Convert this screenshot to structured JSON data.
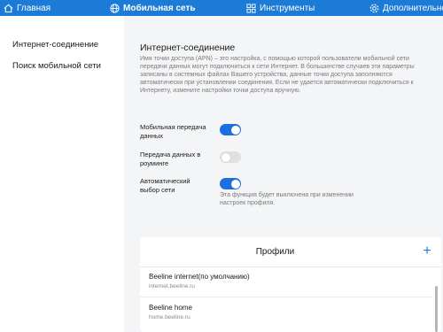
{
  "nav": {
    "home": "Главная",
    "mobile_network": "Мобильная сеть",
    "tools": "Инструменты",
    "advanced": "Дополнительно"
  },
  "sidebar": {
    "items": [
      {
        "label": "Интернет-соединение",
        "active": true
      },
      {
        "label": "Поиск мобильной сети",
        "active": false
      }
    ]
  },
  "section": {
    "title": "Интернет-соединение",
    "description": "Имя точки доступа (APN) – это настройка, с помощью которой пользователи мобильной сети передачи данных могут подключиться к сети Интернет. В большинстве случаев эти параметры записаны в системных файлах Вашего устройства, данные точки доступа заполняются автоматически при установлении соединения. Если не удается автоматически подключиться к Интернету, измените настройки точки доступа вручную."
  },
  "settings": {
    "mobile_data": {
      "label": "Мобильная передача данных",
      "on": true
    },
    "roaming": {
      "label": "Передача данных в роуминге",
      "on": false
    },
    "auto_network": {
      "label": "Автоматический выбор сети",
      "on": true
    },
    "auto_hint": "Эта функция будет выключена при изменении настроек профиля."
  },
  "profiles": {
    "title": "Профили",
    "add_label": "+",
    "items": [
      {
        "name": "Beeline internet(по умолчанию)",
        "apn": "internet.beeline.ru"
      },
      {
        "name": "Beeline home",
        "apn": "home.beeline.ru"
      }
    ]
  },
  "colors": {
    "accent": "#1d7bd8",
    "toggle_on": "#1d6fe0",
    "toggle_off": "#e0e0e0",
    "content_bg": "#f4f5f7"
  }
}
